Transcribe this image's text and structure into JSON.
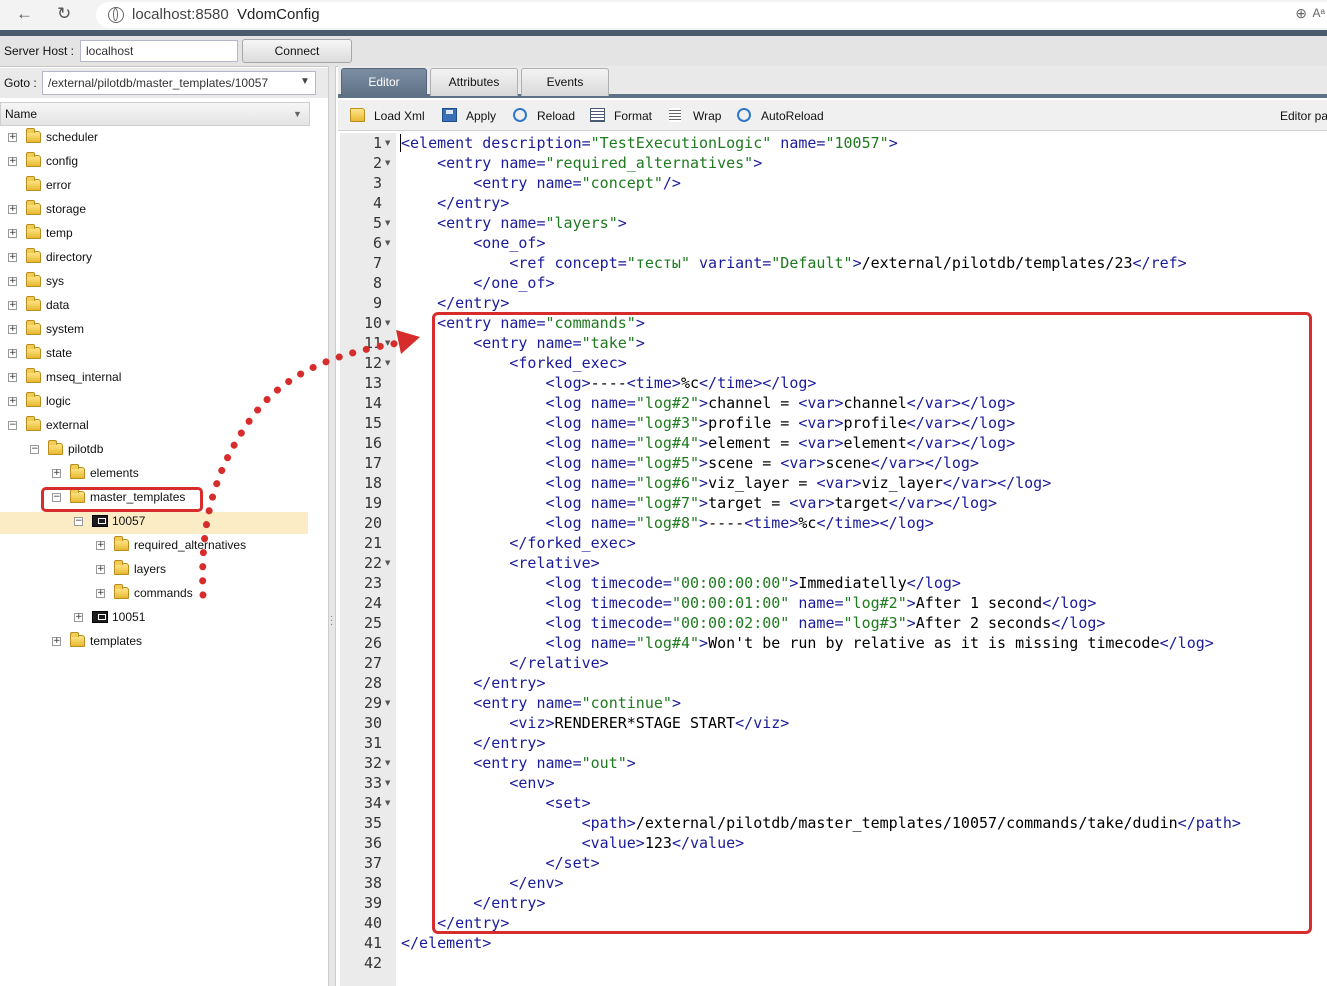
{
  "browser": {
    "url": "localhost:8580",
    "title": "VdomConfig",
    "back_glyph": "←",
    "reload_glyph": "↻",
    "zoom_glyph": "⊕",
    "reader_glyph": "Aᵃ"
  },
  "hostbar": {
    "label": "Server Host :",
    "value": "localhost",
    "connect": "Connect"
  },
  "goto": {
    "label": "Goto :",
    "value": "/external/pilotdb/master_templates/10057"
  },
  "tree": {
    "header": "Name",
    "items": [
      {
        "label": "scheduler",
        "icon": "folder-icon",
        "exp": "+"
      },
      {
        "label": "config",
        "icon": "folder-icon",
        "exp": "+"
      },
      {
        "label": "error",
        "icon": "folder-icon",
        "exp": ""
      },
      {
        "label": "storage",
        "icon": "folder-icon",
        "exp": "+"
      },
      {
        "label": "temp",
        "icon": "folder-icon",
        "exp": "+"
      },
      {
        "label": "directory",
        "icon": "folder-icon",
        "exp": "+"
      },
      {
        "label": "sys",
        "icon": "folder-icon",
        "exp": "+"
      },
      {
        "label": "data",
        "icon": "folder-icon",
        "exp": "+"
      },
      {
        "label": "system",
        "icon": "folder-icon",
        "exp": "+"
      },
      {
        "label": "state",
        "icon": "folder-icon",
        "exp": "+"
      },
      {
        "label": "mseq_internal",
        "icon": "folder-icon",
        "exp": "+"
      },
      {
        "label": "logic",
        "icon": "folder-icon",
        "exp": "+"
      },
      {
        "label": "external",
        "icon": "folder-icon",
        "exp": "−"
      },
      {
        "label": "pilotdb",
        "icon": "folder-icon",
        "exp": "−"
      },
      {
        "label": "elements",
        "icon": "folder-icon",
        "exp": "+"
      },
      {
        "label": "master_templates",
        "icon": "folder-icon",
        "exp": "−"
      },
      {
        "label": "10057",
        "icon": "element-icon",
        "exp": "−",
        "selected": true
      },
      {
        "label": "required_alternatives",
        "icon": "folder-icon",
        "exp": "+"
      },
      {
        "label": "layers",
        "icon": "folder-icon",
        "exp": "+"
      },
      {
        "label": "commands",
        "icon": "folder-icon",
        "exp": "+"
      },
      {
        "label": "10051",
        "icon": "element-icon",
        "exp": "+"
      },
      {
        "label": "templates",
        "icon": "folder-icon",
        "exp": "+"
      }
    ]
  },
  "tabs": [
    {
      "label": "Editor",
      "active": true
    },
    {
      "label": "Attributes",
      "active": false
    },
    {
      "label": "Events",
      "active": false
    }
  ],
  "toolbar": {
    "items": [
      {
        "label": "Load Xml",
        "icon": "folder-open-icon"
      },
      {
        "label": "Apply",
        "icon": "save-icon"
      },
      {
        "label": "Reload",
        "icon": "refresh-icon"
      },
      {
        "label": "Format",
        "icon": "format-icon"
      },
      {
        "label": "Wrap",
        "icon": "wrap-icon"
      },
      {
        "label": "AutoReload",
        "icon": "auto-reload-icon"
      }
    ],
    "right_label": "Editor pa"
  },
  "editor": {
    "lines": [
      "<element description=\"TestExecutionLogic\" name=\"10057\">",
      "    <entry name=\"required_alternatives\">",
      "        <entry name=\"concept\"/>",
      "    </entry>",
      "    <entry name=\"layers\">",
      "        <one_of>",
      "            <ref concept=\"тесты\" variant=\"Default\">/external/pilotdb/templates/23</ref>",
      "        </one_of>",
      "    </entry>",
      "    <entry name=\"commands\">",
      "        <entry name=\"take\">",
      "            <forked_exec>",
      "                <log>----<time>%c</time></log>",
      "                <log name=\"log#2\">channel = <var>channel</var></log>",
      "                <log name=\"log#3\">profile = <var>profile</var></log>",
      "                <log name=\"log#4\">element = <var>element</var></log>",
      "                <log name=\"log#5\">scene = <var>scene</var></log>",
      "                <log name=\"log#6\">viz_layer = <var>viz_layer</var></log>",
      "                <log name=\"log#7\">target = <var>target</var></log>",
      "                <log name=\"log#8\">----<time>%c</time></log>",
      "            </forked_exec>",
      "            <relative>",
      "                <log timecode=\"00:00:00:00\">Immediatelly</log>",
      "                <log timecode=\"00:00:01:00\" name=\"log#2\">After 1 second</log>",
      "                <log timecode=\"00:00:02:00\" name=\"log#3\">After 2 seconds</log>",
      "                <log name=\"log#4\">Won't be run by relative as it is missing timecode</log>",
      "            </relative>",
      "        </entry>",
      "        <entry name=\"continue\">",
      "            <viz>RENDERER*STAGE START</viz>",
      "        </entry>",
      "        <entry name=\"out\">",
      "            <env>",
      "                <set>",
      "                    <path>/external/pilotdb/master_templates/10057/commands/take/dudin</path>",
      "                    <value>123</value>",
      "                </set>",
      "            </env>",
      "        </entry>",
      "    </entry>",
      "</element>",
      ""
    ],
    "fold_lines": [
      1,
      2,
      5,
      6,
      10,
      11,
      12,
      22,
      29,
      32,
      33,
      34
    ]
  },
  "colors": {
    "tag": "#1b1b9a",
    "string": "#1f7a1f",
    "annotation": "#d62c2c",
    "tab_active": "#5f7185",
    "selection": "#fbecc5"
  }
}
